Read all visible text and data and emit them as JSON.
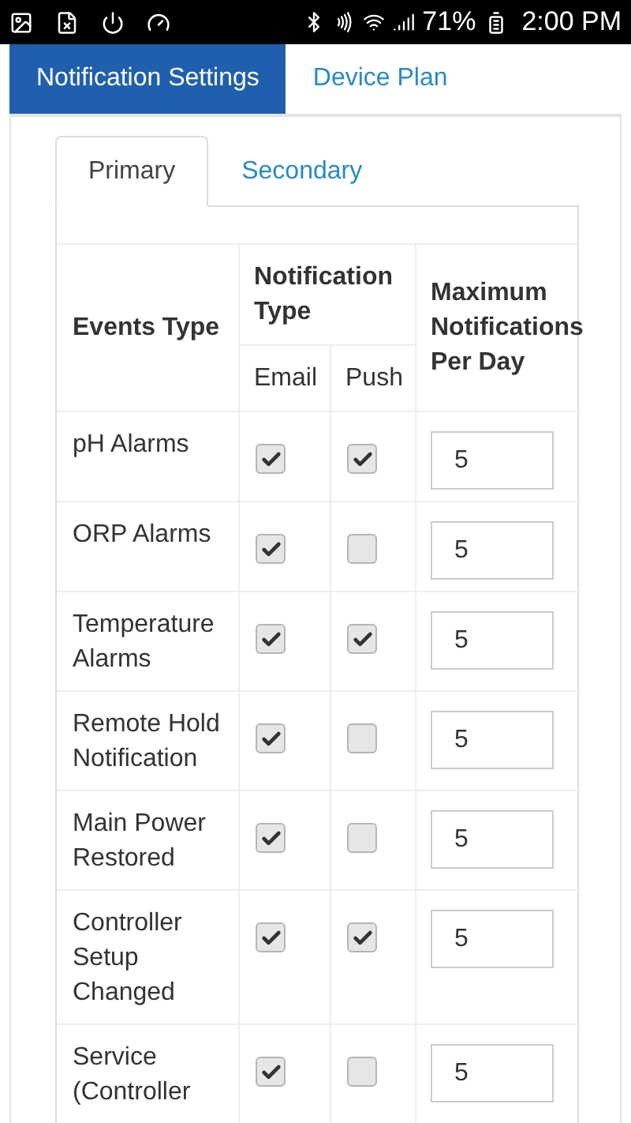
{
  "status_bar": {
    "battery": "71%",
    "time": "2:00 PM"
  },
  "tabs": [
    {
      "label": "Notification Settings",
      "selected": true
    },
    {
      "label": "Device Plan",
      "selected": false
    }
  ],
  "sub_tabs": [
    {
      "label": "Primary",
      "selected": true
    },
    {
      "label": "Secondary",
      "selected": false
    }
  ],
  "table": {
    "columns": {
      "events": "Events Type",
      "type_group": "Notification Type",
      "email": "Email",
      "push": "Push",
      "max": "Maximum Notifications Per Day"
    },
    "rows": [
      {
        "event": "pH Alarms",
        "email": true,
        "push": true,
        "max": "5"
      },
      {
        "event": "ORP Alarms",
        "email": true,
        "push": false,
        "max": "5"
      },
      {
        "event": "Temperature Alarms",
        "email": true,
        "push": true,
        "max": "5"
      },
      {
        "event": "Remote Hold Notification",
        "email": true,
        "push": false,
        "max": "5"
      },
      {
        "event": "Main Power Restored",
        "email": true,
        "push": false,
        "max": "5"
      },
      {
        "event": "Controller Setup Changed",
        "email": true,
        "push": true,
        "max": "5"
      },
      {
        "event": "Service (Controller",
        "email": true,
        "push": false,
        "max": "5"
      }
    ]
  }
}
